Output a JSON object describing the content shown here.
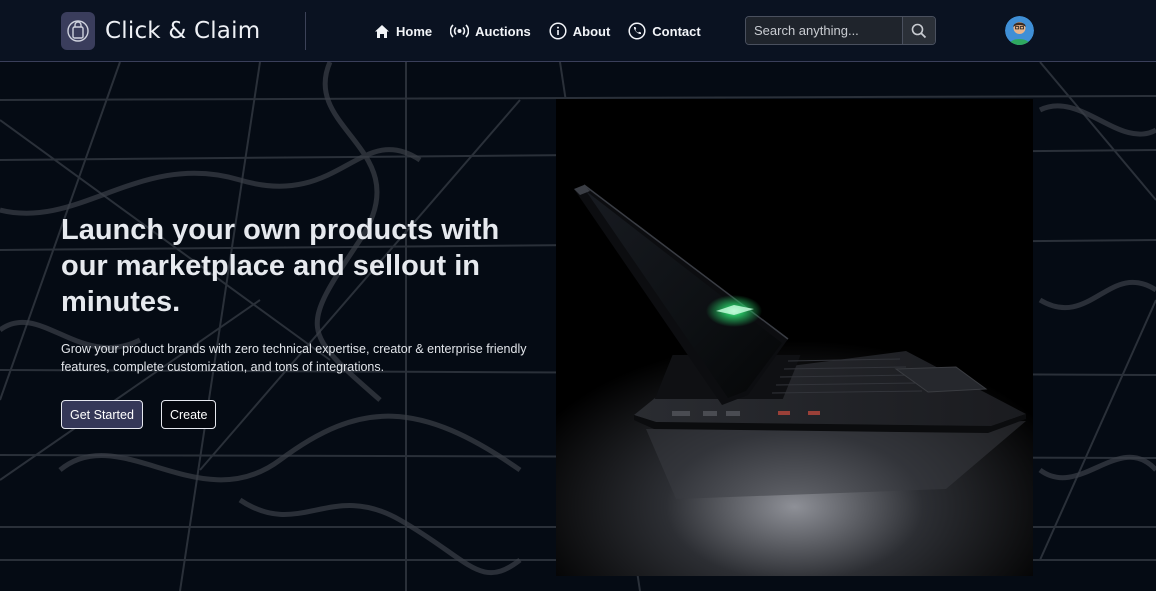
{
  "brand": {
    "name": "Click & Claim",
    "logo_icon": "shopping-bag-icon"
  },
  "nav": {
    "items": [
      {
        "label": "Home",
        "icon": "home-icon"
      },
      {
        "label": "Auctions",
        "icon": "broadcast-icon"
      },
      {
        "label": "About",
        "icon": "info-icon"
      },
      {
        "label": "Contact",
        "icon": "phone-icon"
      }
    ]
  },
  "search": {
    "placeholder": "Search anything...",
    "icon": "search-icon"
  },
  "user": {
    "avatar_icon": "user-avatar"
  },
  "hero": {
    "title": "Launch your own products with our marketplace and sellout in minutes.",
    "description": "Grow your product brands with zero technical expertise, creator & enterprise friendly features, complete customization, and tons of integrations.",
    "primary_button": "Get Started",
    "secondary_button": "Create",
    "image_subject": "laptop"
  },
  "colors": {
    "background": "#050b14",
    "navbar": "#0a1221",
    "primary_button": "#353858",
    "text": "#e6e9ee"
  }
}
